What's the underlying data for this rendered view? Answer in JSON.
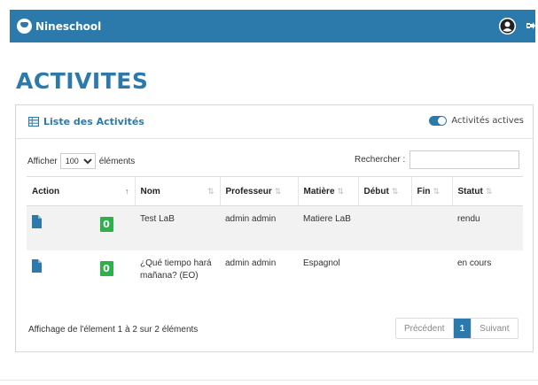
{
  "app": {
    "brand": "Nineschool",
    "accent_color": "#2c79ab",
    "badge_color": "#2eb04a"
  },
  "header": {
    "user_icon": "user-circle-icon",
    "logout_icon": "sign-out-icon"
  },
  "page": {
    "title": "ACTIVITES"
  },
  "panel": {
    "icon": "table-icon",
    "title": "Liste des Activités",
    "toggle_label": "Activités actives",
    "toggle_on": true
  },
  "controls": {
    "length_prefix": "Afficher",
    "length_value": "100",
    "length_suffix": "éléments",
    "search_label": "Rechercher :",
    "search_value": ""
  },
  "table": {
    "columns": [
      "Action",
      "",
      "Nom",
      "Professeur",
      "Matière",
      "Début",
      "Fin",
      "Statut"
    ],
    "rows": [
      {
        "badge": "0",
        "nom": "Test LaB",
        "professeur": "admin admin",
        "matiere": "Matiere LaB",
        "debut": "",
        "fin": "",
        "statut": "rendu"
      },
      {
        "badge": "0",
        "nom": "¿Qué tiempo hará mañana? (EO)",
        "professeur": "admin admin",
        "matiere": "Espagnol",
        "debut": "",
        "fin": "",
        "statut": "en cours"
      }
    ]
  },
  "footer": {
    "info": "Affichage de l'élement 1 à 2 sur 2 éléments",
    "prev": "Précédent",
    "current_page": "1",
    "next": "Suivant"
  }
}
